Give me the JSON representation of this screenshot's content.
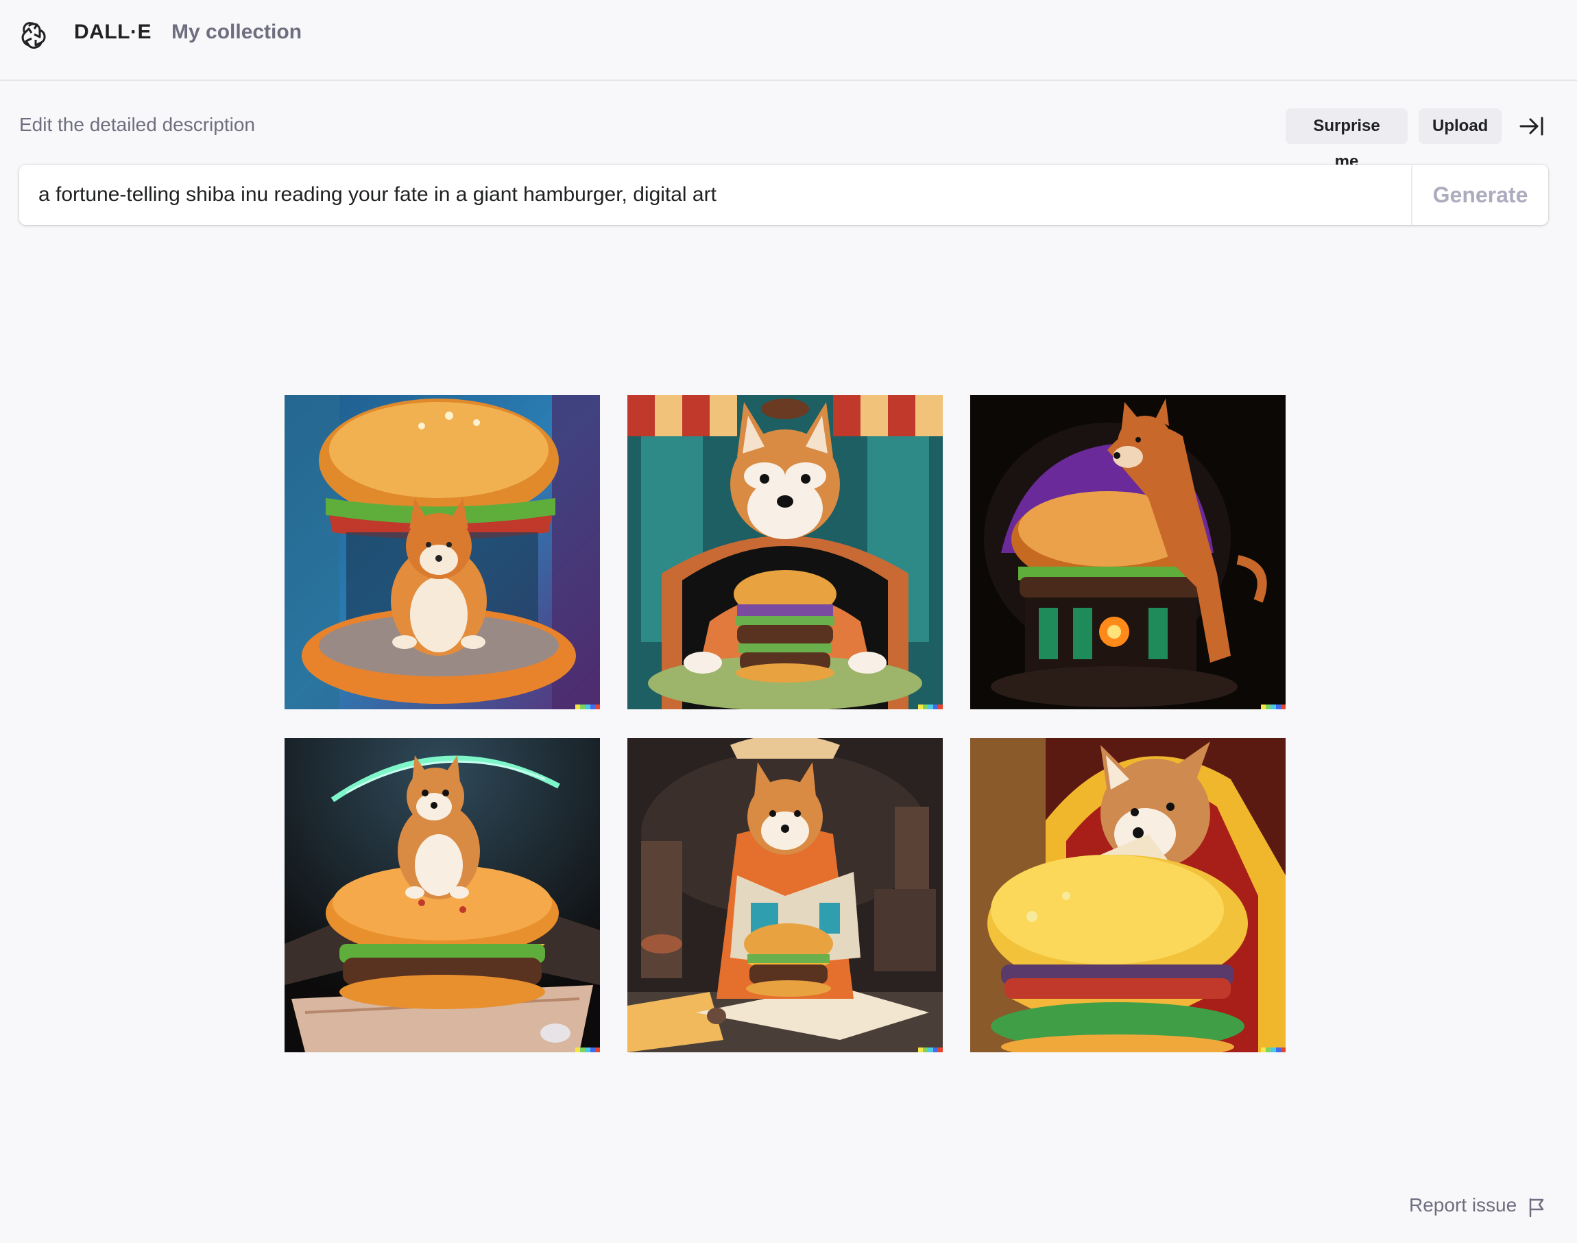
{
  "header": {
    "brand": "DALL·E",
    "nav_collection": "My collection",
    "logo_icon": "openai-logo-icon"
  },
  "prompt": {
    "label": "Edit the detailed description",
    "surprise_label": "Surprise me",
    "upload_label": "Upload",
    "collapse_icon": "collapse-right-icon",
    "value": "a fortune-telling shiba inu reading your fate in a giant hamburger, digital art",
    "generate_label": "Generate"
  },
  "results": {
    "images": [
      {
        "alt": "shiba inu sitting inside a giant hamburger in a blue forest"
      },
      {
        "alt": "shiba inu in an orange robe with a burger under a striped awning"
      },
      {
        "alt": "shiba inu leaning on a giant burger on a dark stage"
      },
      {
        "alt": "shiba inu sitting on top of a giant burger with a glowing halo"
      },
      {
        "alt": "shiba inu reading a book beside a burger in a dim tavern"
      },
      {
        "alt": "shiba inu behind a huge yellow burger in a red booth"
      }
    ],
    "watermark_colors": [
      "#f6e645",
      "#7dd35f",
      "#4dc9e6",
      "#3e6df2",
      "#e8452f"
    ]
  },
  "footer": {
    "report_label": "Report issue",
    "flag_icon": "flag-icon"
  },
  "colors": {
    "background": "#f8f8fa",
    "muted_text": "#6e6e80",
    "pill_bg": "#ececf1",
    "generate_disabled": "#acacbe"
  }
}
